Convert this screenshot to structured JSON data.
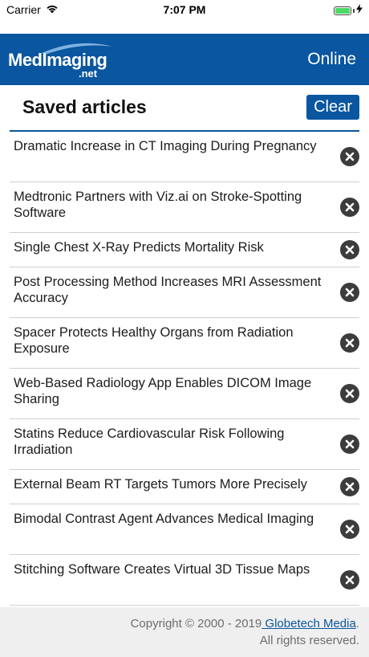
{
  "status_bar": {
    "carrier": "Carrier",
    "time": "7:07 PM",
    "battery_level": 1.0,
    "battery_color": "#4cd964",
    "wifi_icon": "wifi-icon",
    "charging_icon": "bolt-icon"
  },
  "header": {
    "logo_text": "MedImaging",
    "logo_sub": ".net",
    "status": "Online",
    "background_color": "#0a56a0"
  },
  "title_row": {
    "title": "Saved articles",
    "clear_label": "Clear"
  },
  "articles": [
    {
      "title": "Dramatic Increase in CT Imaging During Pregnancy"
    },
    {
      "title": "Medtronic Partners with Viz.ai on Stroke-Spotting Software"
    },
    {
      "title": "Single Chest X-Ray Predicts Mortality Risk"
    },
    {
      "title": "Post Processing Method Increases MRI Assessment Accuracy"
    },
    {
      "title": "Spacer Protects Healthy Organs from Radiation Exposure"
    },
    {
      "title": "Web-Based Radiology App Enables DICOM Image Sharing"
    },
    {
      "title": "Statins Reduce Cardiovascular Risk Following Irradiation"
    },
    {
      "title": "External Beam RT Targets Tumors More Precisely"
    },
    {
      "title": "Bimodal Contrast Agent Advances Medical Imaging"
    },
    {
      "title": "Stitching Software Creates Virtual 3D Tissue Maps"
    }
  ],
  "remove_icon": "close-circle-icon",
  "footer": {
    "copyright": "Copyright © 2000 - 2019",
    "link_text": " Globetech Media",
    "period": ".",
    "rights": "All rights reserved."
  }
}
